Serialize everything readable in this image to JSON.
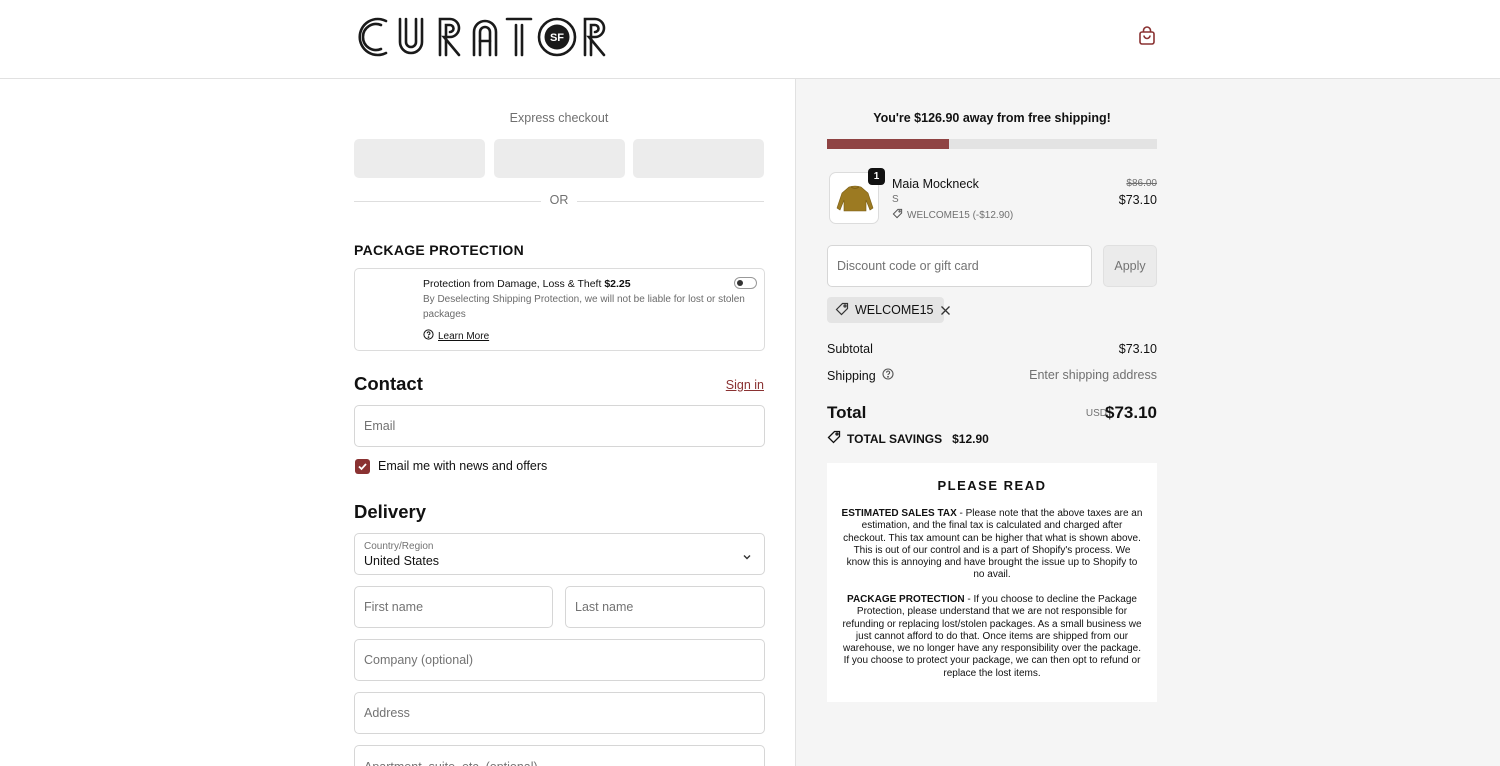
{
  "brand": {
    "name": "CURATOR",
    "badge": "SF",
    "accent": "#8a3232"
  },
  "express": {
    "label": "Express checkout",
    "or_label": "OR"
  },
  "package_protection": {
    "heading": "PACKAGE PROTECTION",
    "title": "Protection from Damage, Loss & Theft",
    "price": "$2.25",
    "description": "By Deselecting Shipping Protection, we will not be liable for lost or stolen packages",
    "learn_more": "Learn More",
    "enabled": false
  },
  "contact": {
    "heading": "Contact",
    "sign_in": "Sign in",
    "email_placeholder": "Email",
    "newsletter_label": "Email me with news and offers",
    "newsletter_checked": true
  },
  "delivery": {
    "heading": "Delivery",
    "country_label": "Country/Region",
    "country_value": "United States",
    "first_name_placeholder": "First name",
    "last_name_placeholder": "Last name",
    "company_placeholder": "Company (optional)",
    "address_placeholder": "Address",
    "apartment_placeholder": "Apartment, suite, etc. (optional)"
  },
  "summary": {
    "free_shipping_message": "You're $126.90 away from free shipping!",
    "free_shipping_progress": 0.37,
    "product": {
      "quantity": "1",
      "name": "Maia Mockneck",
      "variant": "S",
      "discount": "WELCOME15 (-$12.90)",
      "original_price": "$86.00",
      "price": "$73.10"
    },
    "discount_placeholder": "Discount code or gift card",
    "apply_label": "Apply",
    "applied_code": "WELCOME15",
    "subtotal_label": "Subtotal",
    "subtotal_value": "$73.10",
    "shipping_label": "Shipping",
    "shipping_value": "Enter shipping address",
    "total_label": "Total",
    "total_currency": "USD",
    "total_value": "$73.10",
    "savings_label": "TOTAL SAVINGS",
    "savings_value": "$12.90"
  },
  "notice": {
    "title": "PLEASE READ",
    "tax_heading": "ESTIMATED SALES TAX",
    "tax_body": "- Please note that the above taxes are an estimation, and the final tax is calculated and charged after checkout. This tax amount can be higher that what is shown above. This is out of our control and is a part of Shopify's process. We know this is annoying and have brought the issue up to Shopify to no avail.",
    "protection_heading": "PACKAGE PROTECTION",
    "protection_body": "- If you choose to decline the Package Protection, please understand that we are not responsible for refunding or replacing lost/stolen packages. As a small business we just cannot afford to do that. Once items are shipped from our warehouse, we no longer have any responsibility over the package. If you choose to protect your package, we can then opt to refund or replace the lost items."
  },
  "icons": {
    "cart": "shopping-bag-icon",
    "tag": "tag-icon",
    "help": "question-circle-icon",
    "close": "close-icon",
    "chevron": "chevron-down-icon",
    "check": "check-icon"
  }
}
